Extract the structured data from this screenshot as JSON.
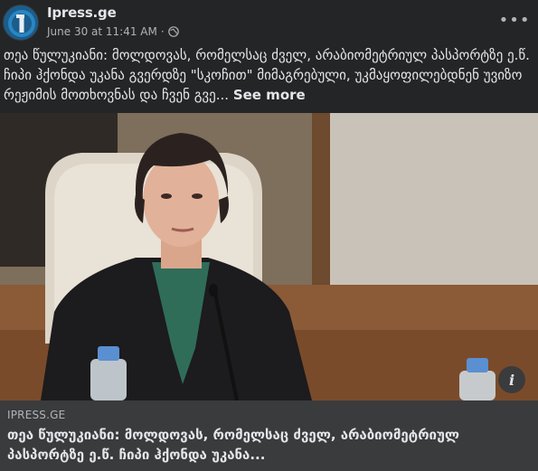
{
  "header": {
    "page_name": "Ipress.ge",
    "timestamp": "June 30 at 11:41 AM",
    "separator": "·",
    "more_label": "•••"
  },
  "caption": {
    "text": "თეა წულუკიანი: მოლდოვას, რომელსაც ძველ, არაბიომეტრიულ პასპორტზე ე.წ. ჩიპი ჰქონდა უკანა გვერდზე \"სკოჩით\" მიმაგრებული, უკმაყოფილებდნენ უვიზო რეჟიმის მოთხოვნას და ჩვენ გვე... ",
    "see_more": "See more"
  },
  "photo": {
    "info_label": "i"
  },
  "link_preview": {
    "domain": "IPRESS.GE",
    "title": "თეა წულუკიანი: მოლდოვას, რომელსაც ძველ, არაბიომეტრიულ პასპორტზე ე.წ. ჩიპი ჰქონდა უკანა..."
  },
  "icons": {
    "globe": "globe-icon",
    "more": "more-options-icon",
    "info": "info-icon"
  },
  "colors": {
    "background": "#242526",
    "link_preview_bg": "#3a3b3c",
    "primary_text": "#e4e6eb",
    "secondary_text": "#b0b3b8"
  }
}
